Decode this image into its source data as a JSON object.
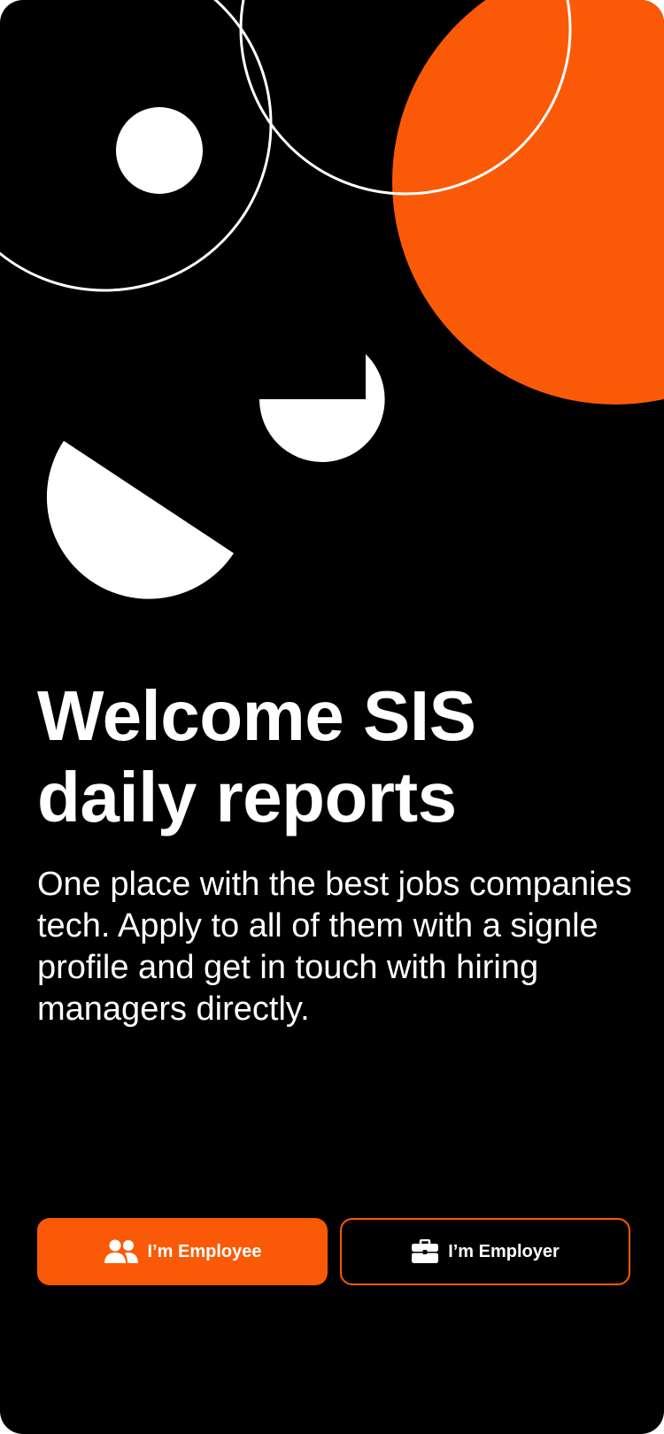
{
  "colors": {
    "background": "#000000",
    "accent": "#FA5A07",
    "text": "#FFFFFF"
  },
  "welcome": {
    "title": "Welcome SIS daily reports",
    "description": "One place with the best jobs companies tech. Apply to all of them with a signle profile and get in touch with hiring managers directly."
  },
  "actions": {
    "employee": {
      "label": "I’m Employee",
      "icon": "users-icon"
    },
    "employer": {
      "label": "I’m Employer",
      "icon": "briefcase-icon"
    }
  }
}
